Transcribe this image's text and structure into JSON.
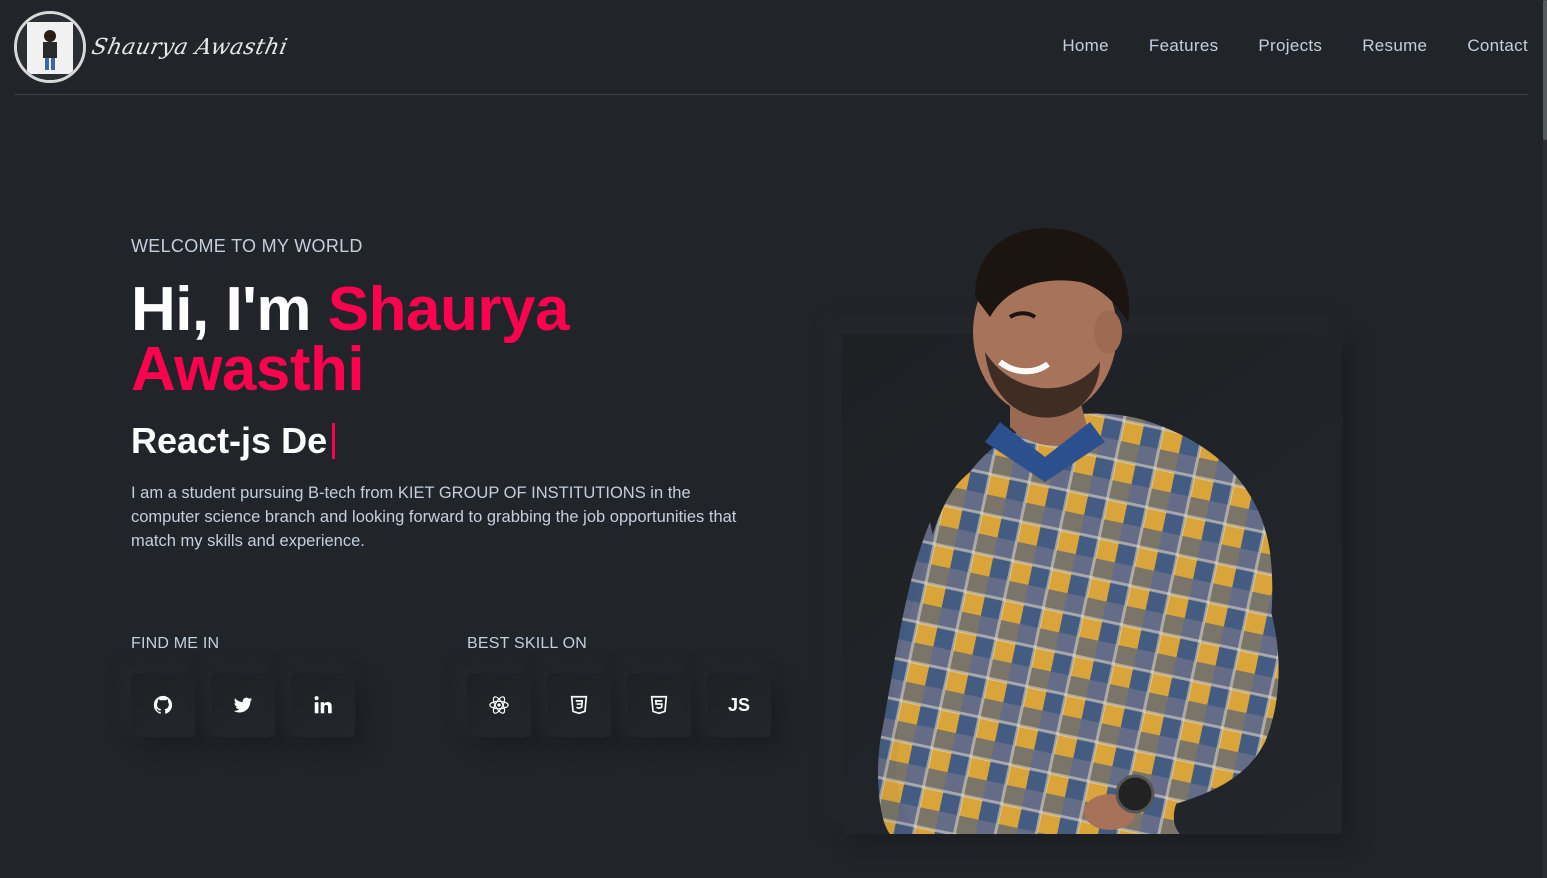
{
  "header": {
    "logo_text": "Shaurya Awasthi",
    "nav": [
      "Home",
      "Features",
      "Projects",
      "Resume",
      "Contact"
    ]
  },
  "hero": {
    "welcome": "WELCOME TO MY WORLD",
    "greeting": "Hi, I'm ",
    "name_first": "Shaurya",
    "name_last": "Awasthi",
    "role_typed": "React-js De",
    "description": "I am a student pursuing B-tech from KIET GROUP OF INSTITUTIONS in the computer science branch and looking forward to grabbing the job opportunities that match my skills and experience.",
    "find_me_label": "FIND ME IN",
    "skills_label": "BEST SKILL ON",
    "social_icons": [
      "github-icon",
      "twitter-icon",
      "linkedin-icon"
    ],
    "skill_icons": [
      "react-icon",
      "css3-icon",
      "html5-icon",
      "javascript-icon"
    ],
    "js_label": "JS"
  },
  "colors": {
    "background": "#212428",
    "accent": "#ff014f",
    "text": "#c4cfde",
    "heading": "#ffffff"
  }
}
